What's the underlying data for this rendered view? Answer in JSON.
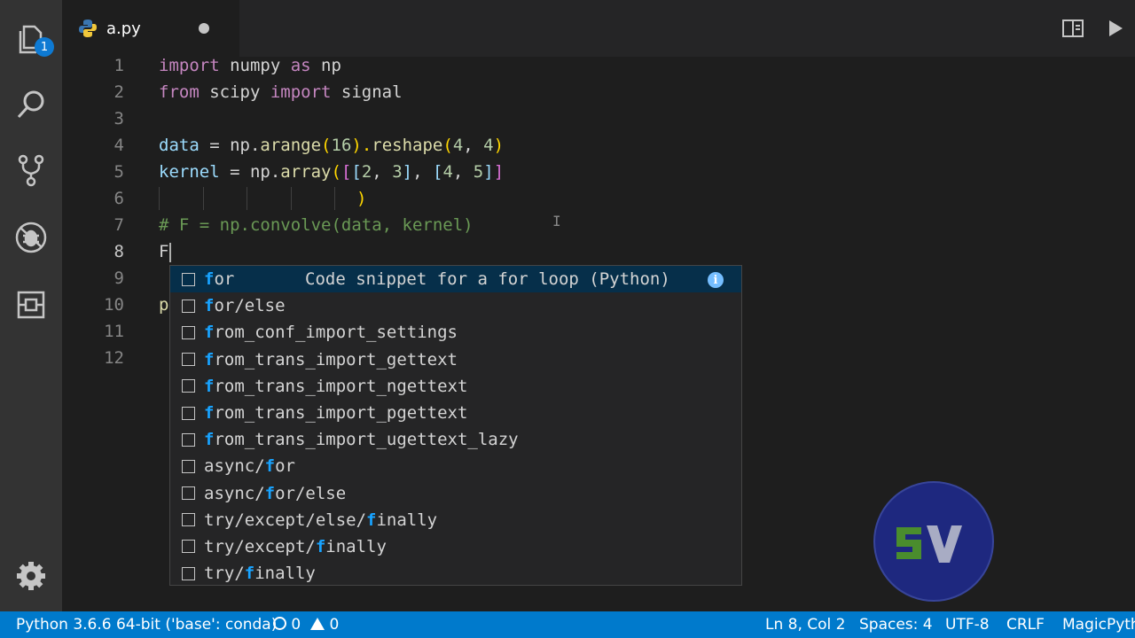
{
  "activity": {
    "explorer_badge": "1",
    "items": [
      "explorer-icon",
      "search-icon",
      "source-control-icon",
      "debug-icon",
      "extensions-icon",
      "settings-gear-icon"
    ]
  },
  "tab": {
    "title": "a.py"
  },
  "editor": {
    "line_numbers": [
      "1",
      "2",
      "3",
      "4",
      "5",
      "6",
      "7",
      "8",
      "9",
      "10",
      "11",
      "12"
    ],
    "lines": {
      "l1_import": "import",
      "l1_rest": " numpy ",
      "l1_as": "as",
      "l1_np": " np",
      "l2_from": "from",
      "l2_scipy": " scipy ",
      "l2_import": "import",
      "l2_signal": " signal",
      "l4_data": "data",
      "l4_eq": " = np.",
      "l4_arange": "arange",
      "l4_p1": "(",
      "l4_16": "16",
      "l4_p2": ").",
      "l4_reshape": "reshape",
      "l4_p3": "(",
      "l4_4a": "4",
      "l4_c": ", ",
      "l4_4b": "4",
      "l4_p4": ")",
      "l5_kernel": "kernel",
      "l5_eq": " = np.",
      "l5_array": "array",
      "l5_p1": "(",
      "l5_b1": "[",
      "l5_b2": "[",
      "l5_2": "2",
      "l5_c1": ", ",
      "l5_3": "3",
      "l5_b3": "]",
      "l5_c2": ", ",
      "l5_b4": "[",
      "l5_4": "4",
      "l5_c3": ", ",
      "l5_5": "5",
      "l5_b5": "]",
      "l5_b6": "]",
      "l6_paren": ")",
      "l7_comment": "# F = np.convolve(data, kernel)",
      "l8_text": "F",
      "l10_text": "p"
    }
  },
  "suggest": {
    "items": [
      {
        "hl": "f",
        "rest": "or",
        "pre": ""
      },
      {
        "hl": "f",
        "rest": "or/else",
        "pre": ""
      },
      {
        "hl": "f",
        "rest": "rom_conf_import_settings",
        "pre": ""
      },
      {
        "hl": "f",
        "rest": "rom_trans_import_gettext",
        "pre": ""
      },
      {
        "hl": "f",
        "rest": "rom_trans_import_ngettext",
        "pre": ""
      },
      {
        "hl": "f",
        "rest": "rom_trans_import_pgettext",
        "pre": ""
      },
      {
        "hl": "f",
        "rest": "rom_trans_import_ugettext_lazy",
        "pre": ""
      },
      {
        "pre": "async/",
        "hl": "f",
        "rest": "or"
      },
      {
        "pre": "async/",
        "hl": "f",
        "rest": "or/else"
      },
      {
        "pre": "try/except/else/",
        "hl": "f",
        "rest": "inally"
      },
      {
        "pre": "try/except/",
        "hl": "f",
        "rest": "inally"
      },
      {
        "pre": "try/",
        "hl": "f",
        "rest": "inally"
      }
    ],
    "selected_detail": "Code snippet for a for loop (Python)",
    "info_glyph": "i"
  },
  "statusbar": {
    "interpreter": "Python 3.6.6 64-bit ('base': conda)",
    "errors": "0",
    "warnings": "0",
    "position": "Ln 8, Col 2",
    "spaces": "Spaces: 4",
    "encoding": "UTF-8",
    "eol": "CRLF",
    "extension": "MagicPyth"
  }
}
